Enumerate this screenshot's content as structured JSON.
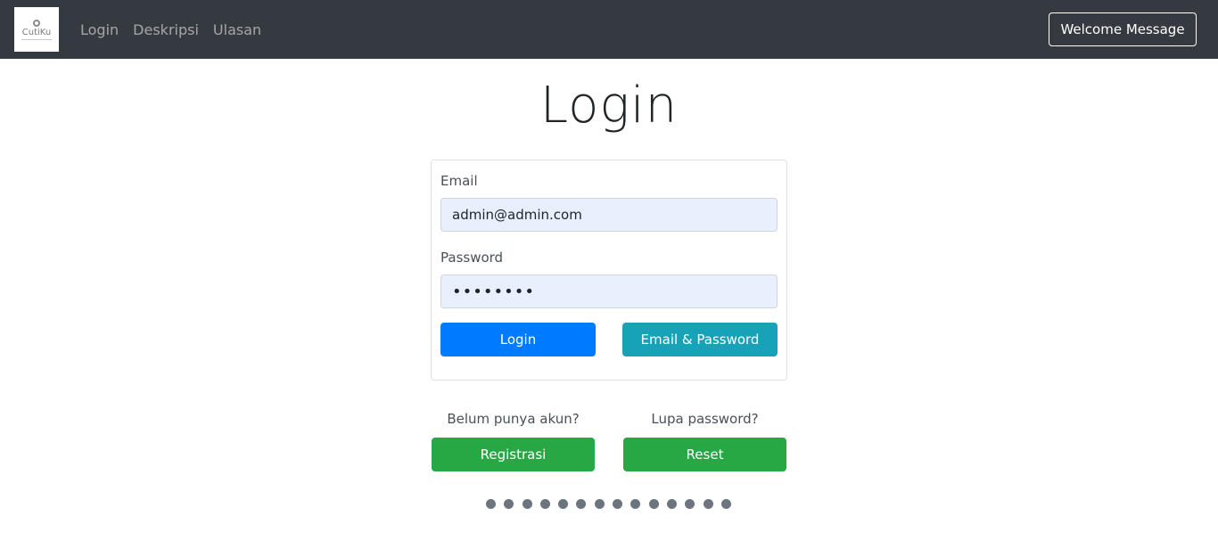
{
  "navbar": {
    "logo_text": "CutiKu",
    "links": [
      "Login",
      "Deskripsi",
      "Ulasan"
    ],
    "welcome_label": "Welcome Message"
  },
  "page": {
    "title": "Login"
  },
  "form": {
    "email_label": "Email",
    "email_value": "admin@admin.com",
    "password_label": "Password",
    "password_value": "••••••••",
    "login_button": "Login",
    "email_password_button": "Email & Password"
  },
  "extra": {
    "register_hint": "Belum punya akun?",
    "register_button": "Registrasi",
    "reset_hint": "Lupa password?",
    "reset_button": "Reset"
  },
  "carousel": {
    "dot_count": 14
  },
  "colors": {
    "navbar": "#343a40",
    "primary": "#007bff",
    "info": "#17a2b8",
    "success": "#28a745",
    "input_autofill": "#e8f0fe",
    "dot": "#6c757d"
  }
}
